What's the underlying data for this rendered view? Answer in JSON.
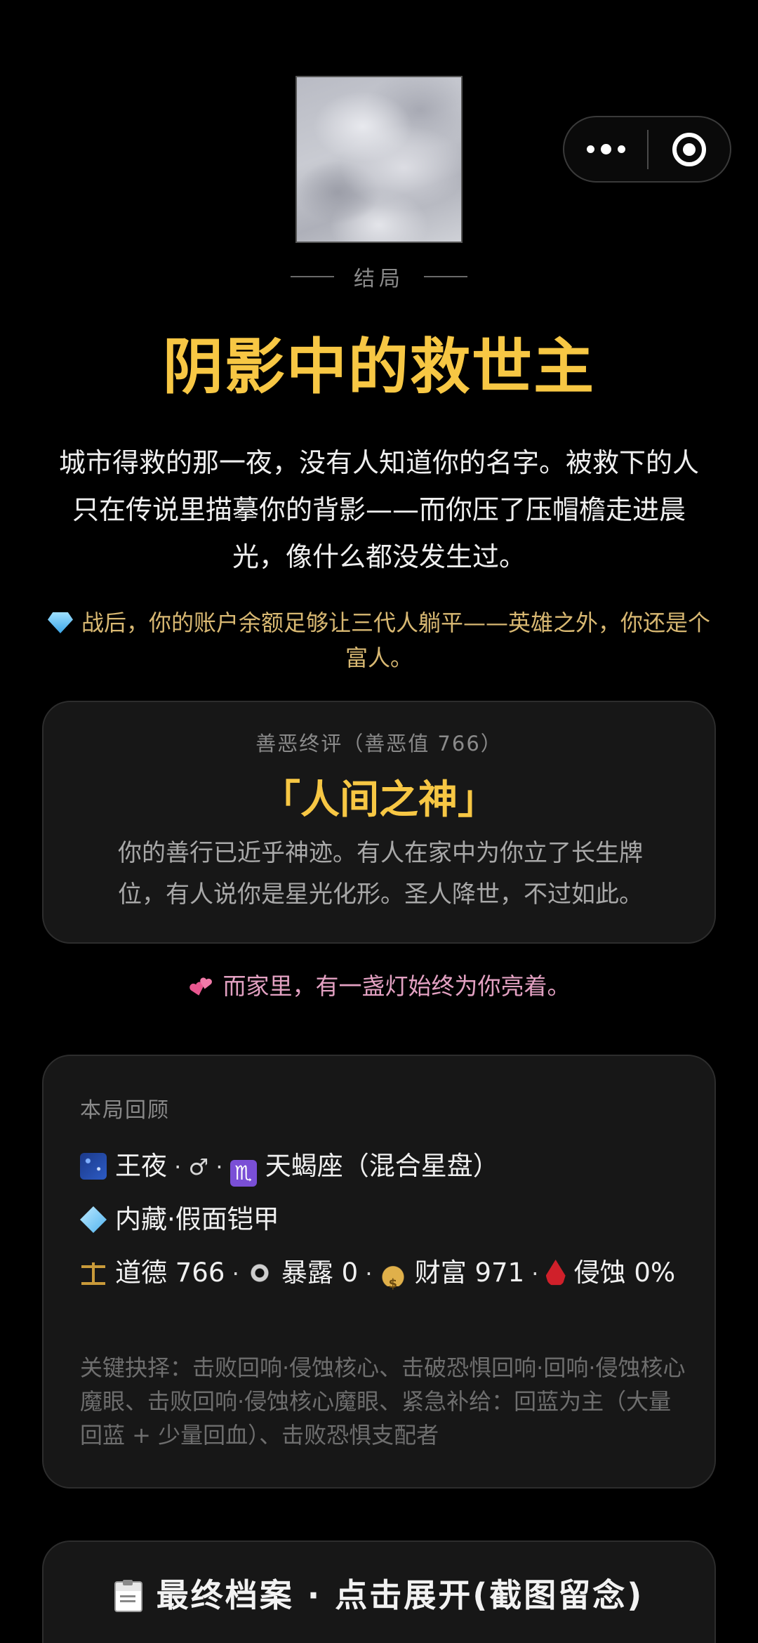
{
  "capsule": {
    "more_icon": "more-dots-icon",
    "close_icon": "target-close-icon"
  },
  "ending": {
    "label": "结局",
    "title": "阴影中的救世主",
    "story": "城市得救的那一夜，没有人知道你的名字。被救下的人只在传说里描摹你的背影——而你压了压帽檐走进晨光，像什么都没发生过。",
    "wealth_note": "战后，你的账户余额足够让三代人躺平——英雄之外，你还是个富人。"
  },
  "verdict": {
    "label": "善恶终评（善恶值 766）",
    "name": "「人间之神」",
    "desc": "你的善行已近乎神迹。有人在家中为你立了长生牌位，有人说你是星光化形。圣人降世，不过如此。"
  },
  "family_note": "而家里，有一盏灯始终为你亮着。",
  "review": {
    "label": "本局回顾",
    "name": "王夜",
    "gender_symbol": "♂",
    "sign": "天蝎座（混合星盘）",
    "talent": "内藏·假面铠甲",
    "stats": {
      "morality_label": "道德",
      "morality": "766",
      "exposure_label": "暴露",
      "exposure": "0",
      "wealth_label": "财富",
      "wealth": "971",
      "erosion_label": "侵蚀",
      "erosion": "0%"
    },
    "key_choices": "关键抉择：击败回响·侵蚀核心、击破恐惧回响·回响·侵蚀核心魔眼、击败回响·侵蚀核心魔眼、紧急补给：回蓝为主（大量回蓝 + 少量回血）、击败恐惧支配者"
  },
  "final_button": {
    "label": "最终档案 · 点击展开(截图留念)"
  },
  "colors": {
    "gold": "#f7c744",
    "pink": "#e3a1c2",
    "tan": "#d8b872",
    "card_bg": "#171717"
  }
}
